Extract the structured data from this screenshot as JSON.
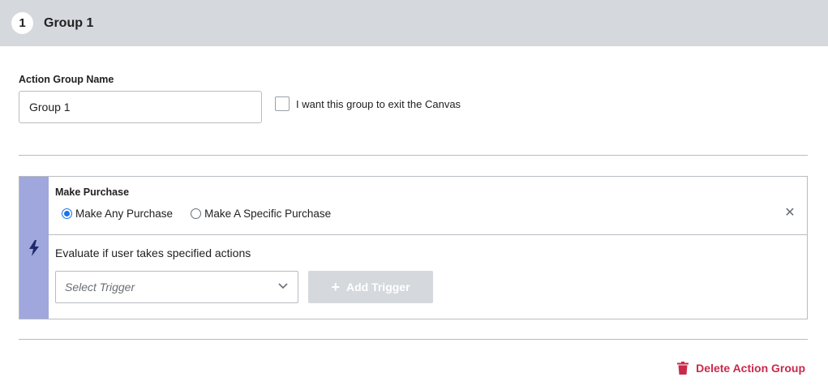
{
  "header": {
    "step_number": "1",
    "title": "Group 1"
  },
  "form": {
    "name_label": "Action Group Name",
    "name_value": "Group 1",
    "exit_checkbox_label": "I want this group to exit the Canvas",
    "exit_checked": false
  },
  "action": {
    "icon": "lightning-bolt-icon",
    "title": "Make Purchase",
    "options": [
      {
        "label": "Make Any Purchase",
        "selected": true
      },
      {
        "label": "Make A Specific Purchase",
        "selected": false
      }
    ],
    "evaluate_text": "Evaluate if user takes specified actions",
    "trigger_placeholder": "Select Trigger",
    "add_trigger_label": "Add Trigger"
  },
  "footer": {
    "delete_label": "Delete Action Group"
  },
  "colors": {
    "header_bg": "#d5d8dc",
    "strip": "#a0a7dc",
    "danger": "#c92a4a",
    "radio_accent": "#1a73e8"
  }
}
